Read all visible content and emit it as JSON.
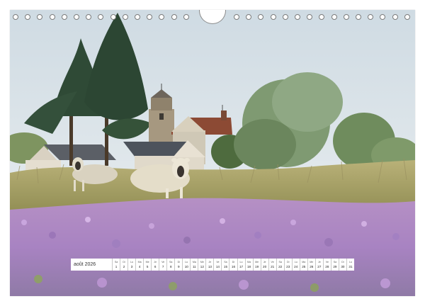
{
  "calendar": {
    "month_label": "août 2026",
    "days": [
      {
        "name": "Sa",
        "num": "1"
      },
      {
        "name": "Di",
        "num": "2"
      },
      {
        "name": "Lu",
        "num": "3"
      },
      {
        "name": "Ma",
        "num": "4"
      },
      {
        "name": "Me",
        "num": "5"
      },
      {
        "name": "Je",
        "num": "6"
      },
      {
        "name": "Ve",
        "num": "7"
      },
      {
        "name": "Sa",
        "num": "8"
      },
      {
        "name": "Di",
        "num": "9"
      },
      {
        "name": "Lu",
        "num": "10"
      },
      {
        "name": "Ma",
        "num": "11"
      },
      {
        "name": "Me",
        "num": "12"
      },
      {
        "name": "Je",
        "num": "13"
      },
      {
        "name": "Ve",
        "num": "14"
      },
      {
        "name": "Sa",
        "num": "15"
      },
      {
        "name": "Di",
        "num": "16"
      },
      {
        "name": "Lu",
        "num": "17"
      },
      {
        "name": "Ma",
        "num": "18"
      },
      {
        "name": "Me",
        "num": "19"
      },
      {
        "name": "Je",
        "num": "20"
      },
      {
        "name": "Ve",
        "num": "21"
      },
      {
        "name": "Sa",
        "num": "22"
      },
      {
        "name": "Di",
        "num": "23"
      },
      {
        "name": "Lu",
        "num": "24"
      },
      {
        "name": "Ma",
        "num": "25"
      },
      {
        "name": "Me",
        "num": "26"
      },
      {
        "name": "Je",
        "num": "27"
      },
      {
        "name": "Ve",
        "num": "28"
      },
      {
        "name": "Sa",
        "num": "29"
      },
      {
        "name": "Di",
        "num": "30"
      },
      {
        "name": "Lu",
        "num": "31"
      }
    ]
  },
  "colors": {
    "sky": "#dde6ec",
    "lavender": "#b38ad0",
    "grass": "#b7ae72",
    "foliage": "#6e8f55",
    "pine": "#2f4a36"
  }
}
